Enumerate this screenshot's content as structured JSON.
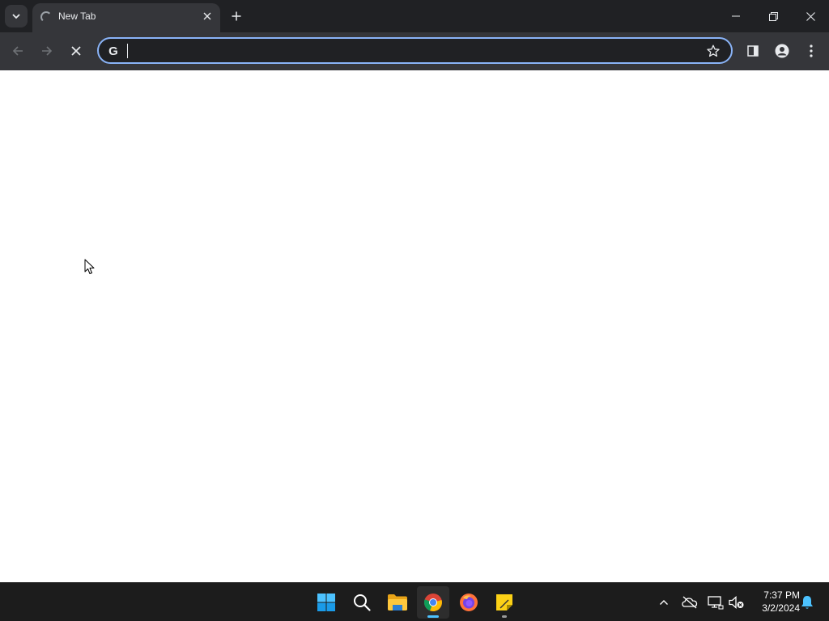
{
  "browser": {
    "tab": {
      "title": "New Tab",
      "loading": true
    },
    "omnibox": {
      "value": "",
      "placeholder": "",
      "search_engine_icon": "google-g-icon",
      "google_letter": "G"
    },
    "icons": {
      "tab_search": "chevron-down-icon",
      "tab_close": "close-icon",
      "new_tab": "plus-icon",
      "minimize": "minimize-icon",
      "restore": "restore-icon",
      "close_window": "close-icon",
      "back": "arrow-left-icon",
      "forward": "arrow-right-icon",
      "stop": "stop-icon",
      "bookmark": "star-icon",
      "side_panel": "side-panel-icon",
      "profile": "profile-icon",
      "menu": "kebab-menu-icon"
    },
    "colors": {
      "tabstrip": "#202124",
      "toolbar": "#35363a",
      "omnibox_border": "#8ab4f8",
      "text": "#e8eaed"
    }
  },
  "taskbar": {
    "apps": [
      {
        "name": "Start",
        "icon": "windows-start-icon"
      },
      {
        "name": "Search",
        "icon": "search-icon"
      },
      {
        "name": "File Explorer",
        "icon": "folder-icon"
      },
      {
        "name": "Google Chrome",
        "icon": "chrome-icon",
        "active": true
      },
      {
        "name": "Firefox",
        "icon": "firefox-icon"
      },
      {
        "name": "Sticky Notes",
        "icon": "sticky-notes-icon"
      }
    ],
    "tray": {
      "icons": [
        "chevron-up-icon",
        "onedrive-offline-icon",
        "network-icon",
        "volume-muted-icon",
        "notification-bell-icon"
      ]
    },
    "clock": {
      "time": "7:37 PM",
      "date": "3/2/2024"
    }
  }
}
